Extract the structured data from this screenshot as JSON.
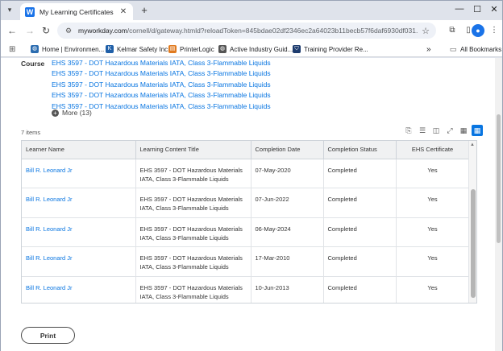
{
  "browser": {
    "tab_title": "My Learning Certificates - Wor",
    "tab_favicon": "W",
    "new_tab": "+",
    "url_host": "myworkday.com",
    "url_path": "/cornell/d/gateway.htmld?reloadToken=845bdae02df2346ec2a64023b11becb57f6daf6930df031...",
    "bookmarks": [
      {
        "label": "Home | Environmen...",
        "icon": "globe-icon",
        "color": "#2b6cb0"
      },
      {
        "label": "Kelmar Safety Inc.",
        "icon": "k-logo-icon",
        "color": "#1f5fa8"
      },
      {
        "label": "PrinterLogic",
        "icon": "printer-icon",
        "color": "#e07a1f"
      },
      {
        "label": "Active Industry Guid...",
        "icon": "globe-icon",
        "color": "#555555"
      },
      {
        "label": "Training Provider Re...",
        "icon": "shield-icon",
        "color": "#1d3b6e"
      }
    ],
    "all_bookmarks": "All Bookmarks",
    "overflow": "»"
  },
  "course": {
    "label": "Course",
    "items": [
      "EHS 3597 - DOT Hazardous Materials IATA, Class 3-Flammable Liquids",
      "EHS 3597 - DOT Hazardous Materials IATA, Class 3-Flammable Liquids",
      "EHS 3597 - DOT Hazardous Materials IATA, Class 3-Flammable Liquids",
      "EHS 3597 - DOT Hazardous Materials IATA, Class 3-Flammable Liquids",
      "EHS 3597 - DOT Hazardous Materials IATA, Class 3-Flammable Liquids"
    ],
    "more_label": "More (13)"
  },
  "grid": {
    "items_count": "7 items",
    "columns": [
      "Learner Name",
      "Learning Content Title",
      "Completion Date",
      "Completion Status",
      "EHS Certificate"
    ],
    "rows": [
      {
        "learner": "Bill R. Leonard Jr",
        "title": "EHS 3597 - DOT Hazardous Materials IATA, Class 3-Flammable Liquids",
        "date": "07-May-2020",
        "status": "Completed",
        "cert": "Yes"
      },
      {
        "learner": "Bill R. Leonard Jr",
        "title": "EHS 3597 - DOT Hazardous Materials IATA, Class 3-Flammable Liquids",
        "date": "07-Jun-2022",
        "status": "Completed",
        "cert": "Yes"
      },
      {
        "learner": "Bill R. Leonard Jr",
        "title": "EHS 3597 - DOT Hazardous Materials IATA, Class 3-Flammable Liquids",
        "date": "06-May-2024",
        "status": "Completed",
        "cert": "Yes"
      },
      {
        "learner": "Bill R. Leonard Jr",
        "title": "EHS 3597 - DOT Hazardous Materials IATA, Class 3-Flammable Liquids",
        "date": "17-Mar-2010",
        "status": "Completed",
        "cert": "Yes"
      },
      {
        "learner": "Bill R. Leonard Jr",
        "title": "EHS 3597 - DOT Hazardous Materials IATA, Class 3-Flammable Liquids",
        "date": "10-Jun-2013",
        "status": "Completed",
        "cert": "Yes"
      }
    ]
  },
  "actions": {
    "print_label": "Print"
  },
  "colors": {
    "link": "#0875e1",
    "accent": "#0875e1"
  }
}
